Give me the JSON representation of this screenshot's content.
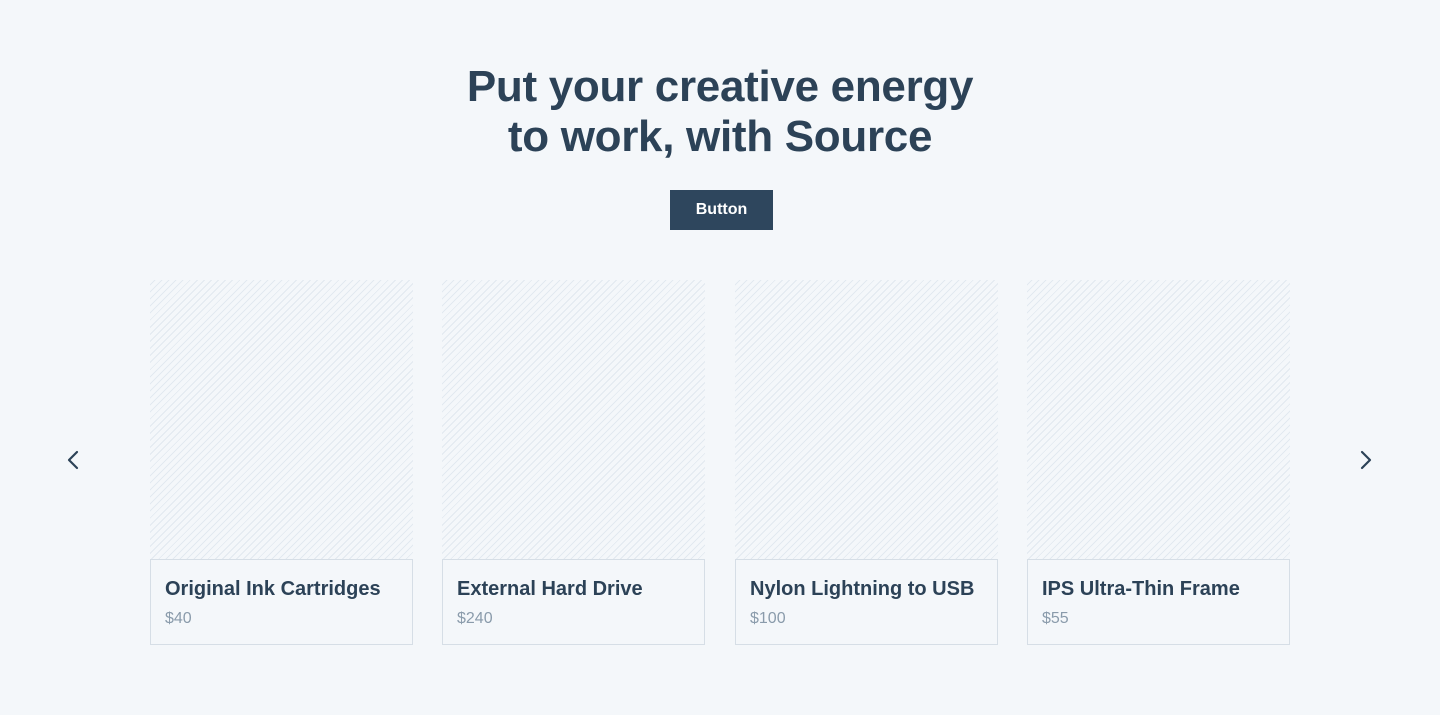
{
  "hero": {
    "title_line1": "Put your creative energy",
    "title_line2": "to work, with Source",
    "button_label": "Button"
  },
  "carousel": {
    "prev_icon": "chevron-left-icon",
    "next_icon": "chevron-right-icon",
    "products": [
      {
        "name": "Original Ink Cartridges",
        "price": "$40"
      },
      {
        "name": "External Hard Drive",
        "price": "$240"
      },
      {
        "name": "Nylon Lightning to USB",
        "price": "$100"
      },
      {
        "name": "IPS Ultra-Thin Frame",
        "price": "$55"
      }
    ]
  },
  "colors": {
    "background": "#f4f7fa",
    "primary": "#2e465d",
    "heading": "#2c4257",
    "muted": "#8a9bab",
    "border": "#d6dee6"
  }
}
